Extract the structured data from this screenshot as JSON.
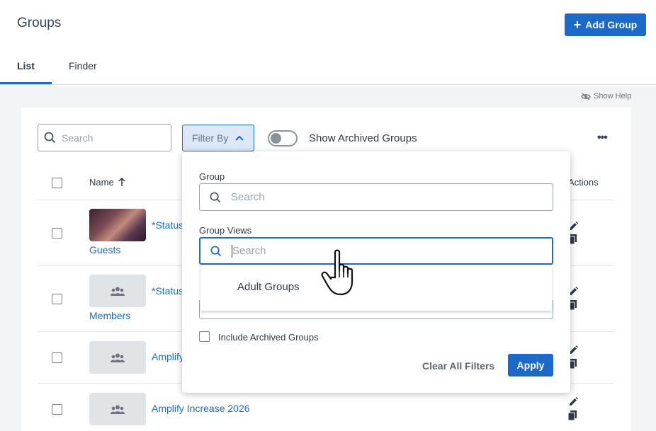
{
  "header": {
    "title": "Groups",
    "add_button_label": "Add Group"
  },
  "tabs": [
    {
      "label": "List",
      "active": true
    },
    {
      "label": "Finder",
      "active": false
    }
  ],
  "help": {
    "label": "Show Help"
  },
  "toolbar": {
    "search_placeholder": "Search",
    "filter_label": "Filter By",
    "archived_toggle_label": "Show Archived Groups",
    "archived_toggle_on": false
  },
  "table": {
    "columns": {
      "name": "Name",
      "actions": "Actions"
    },
    "rows": [
      {
        "name_line1": "*Status",
        "name_line2": "Guests",
        "thumbnail": "photo"
      },
      {
        "name_line1": "*Status",
        "name_line2": "Members",
        "thumbnail": "group-icon"
      },
      {
        "name_line1": "Amplify",
        "name_line2": "",
        "thumbnail": "group-icon"
      },
      {
        "name_line1": "Amplify Increase 2026",
        "name_line2": "",
        "thumbnail": "group-icon"
      }
    ]
  },
  "filter_panel": {
    "group_label": "Group",
    "group_search_placeholder": "Search",
    "group_views_label": "Group Views",
    "group_views_search_placeholder": "Search",
    "group_views_options": [
      "Adult Groups"
    ],
    "include_archived_label": "Include Archived Groups",
    "clear_label": "Clear All Filters",
    "apply_label": "Apply"
  },
  "colors": {
    "accent": "#1b6ac9",
    "link": "#1b6ac9",
    "background": "#f3f4f6"
  }
}
